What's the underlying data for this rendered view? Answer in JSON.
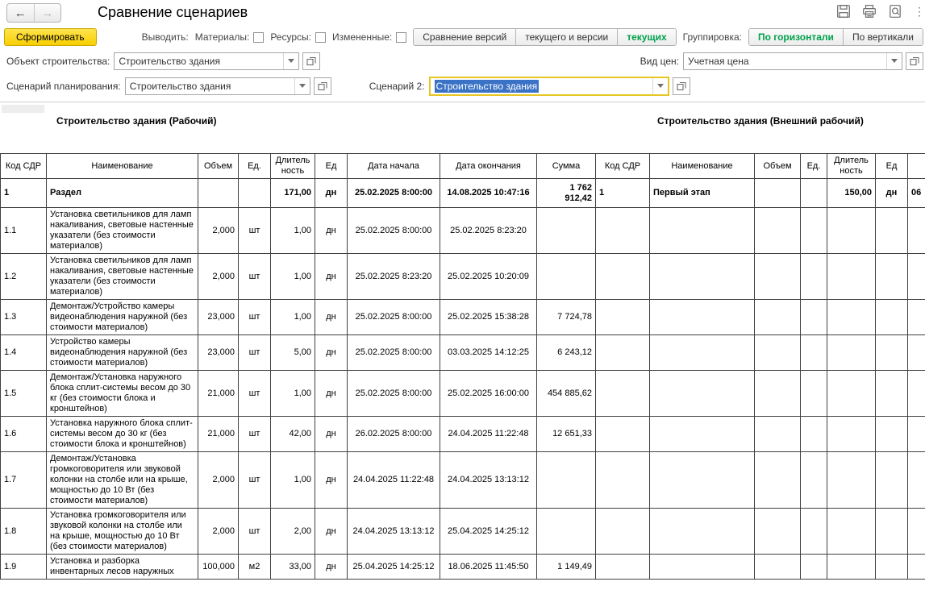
{
  "header": {
    "title": "Сравнение сценариев",
    "back_icon": "←",
    "forward_icon": "→"
  },
  "toolbar": {
    "generate_label": "Сформировать",
    "output_label": "Выводить:",
    "checkboxes": [
      {
        "label": "Материалы:",
        "checked": false
      },
      {
        "label": "Ресурсы:",
        "checked": false
      },
      {
        "label": "Измененные:",
        "checked": false
      }
    ],
    "compare_buttons": [
      {
        "label": "Сравнение версий",
        "selected": false
      },
      {
        "label": "текущего и версии",
        "selected": false
      },
      {
        "label": "текущих",
        "selected": true
      }
    ],
    "grouping_label": "Группировка:",
    "grouping_buttons": [
      {
        "label": "По горизонтали",
        "selected": true
      },
      {
        "label": "По вертикали",
        "selected": false
      }
    ],
    "accent_green": "#00a14b",
    "accent_yellow": "#f8cf02"
  },
  "filters": {
    "object_label": "Объект строительства:",
    "object_value": "Строительство здания",
    "price_label": "Вид цен:",
    "price_value": "Учетная цена",
    "scenario_label": "Сценарий планирования:",
    "scenario_value": "Строительство здания",
    "scenario2_label": "Сценарий 2:",
    "scenario2_value": "Строительство здания",
    "scenario2_selection_color": "#3a72c6",
    "scenario2_focus_border": "#e7c522"
  },
  "report": {
    "left_title": "Строительство здания (Рабочий)",
    "right_title": "Строительство здания (Внешний рабочий)",
    "columns": [
      "Код СДР",
      "Наименование",
      "Объем",
      "Ед.",
      "Длитель ность",
      "Ед",
      "Дата начала",
      "Дата окончания",
      "Сумма",
      "Код СДР",
      "Наименование",
      "Объем",
      "Ед.",
      "Длитель ность",
      "Ед",
      ""
    ],
    "rows": [
      {
        "bold": true,
        "cells": [
          "1",
          "Раздел",
          "",
          "",
          "171,00",
          "дн",
          "25.02.2025 8:00:00",
          "14.08.2025 10:47:16",
          "1 762 912,42",
          "1",
          "Первый этап",
          "",
          "",
          "150,00",
          "дн",
          "06"
        ]
      },
      {
        "cells": [
          "1.1",
          "Установка светильников для ламп накаливания, световые настенные указатели (без стоимости материалов)",
          "2,000",
          "шт",
          "1,00",
          "дн",
          "25.02.2025 8:00:00",
          "25.02.2025 8:23:20",
          "",
          "",
          "",
          "",
          "",
          "",
          "",
          ""
        ]
      },
      {
        "cells": [
          "1.2",
          "Установка светильников для ламп накаливания, световые настенные указатели (без стоимости материалов)",
          "2,000",
          "шт",
          "1,00",
          "дн",
          "25.02.2025 8:23:20",
          "25.02.2025 10:20:09",
          "",
          "",
          "",
          "",
          "",
          "",
          "",
          ""
        ]
      },
      {
        "cells": [
          "1.3",
          "Демонтаж/Устройство камеры видеонаблюдения наружной (без стоимости материалов)",
          "23,000",
          "шт",
          "1,00",
          "дн",
          "25.02.2025 8:00:00",
          "25.02.2025 15:38:28",
          "7 724,78",
          "",
          "",
          "",
          "",
          "",
          "",
          ""
        ]
      },
      {
        "cells": [
          "1.4",
          "Устройство камеры видеонаблюдения наружной (без стоимости материалов)",
          "23,000",
          "шт",
          "5,00",
          "дн",
          "25.02.2025 8:00:00",
          "03.03.2025 14:12:25",
          "6 243,12",
          "",
          "",
          "",
          "",
          "",
          "",
          ""
        ]
      },
      {
        "cells": [
          "1.5",
          "Демонтаж/Установка наружного блока сплит-системы весом до 30 кг (без стоимости блока и кронштейнов)",
          "21,000",
          "шт",
          "1,00",
          "дн",
          "25.02.2025 8:00:00",
          "25.02.2025 16:00:00",
          "454 885,62",
          "",
          "",
          "",
          "",
          "",
          "",
          ""
        ]
      },
      {
        "cells": [
          "1.6",
          "Установка наружного блока сплит-системы весом до 30 кг (без стоимости блока и кронштейнов)",
          "21,000",
          "шт",
          "42,00",
          "дн",
          "26.02.2025 8:00:00",
          "24.04.2025 11:22:48",
          "12 651,33",
          "",
          "",
          "",
          "",
          "",
          "",
          ""
        ]
      },
      {
        "cells": [
          "1.7",
          "Демонтаж/Установка громкоговорителя или звуковой колонки на столбе или на крыше, мощностью до 10 Вт (без стоимости материалов)",
          "2,000",
          "шт",
          "1,00",
          "дн",
          "24.04.2025 11:22:48",
          "24.04.2025 13:13:12",
          "",
          "",
          "",
          "",
          "",
          "",
          "",
          ""
        ]
      },
      {
        "cells": [
          "1.8",
          "Установка громкоговорителя или звуковой колонки на столбе или на крыше, мощностью до 10 Вт (без стоимости материалов)",
          "2,000",
          "шт",
          "2,00",
          "дн",
          "24.04.2025 13:13:12",
          "25.04.2025 14:25:12",
          "",
          "",
          "",
          "",
          "",
          "",
          "",
          ""
        ]
      },
      {
        "cells": [
          "1.9",
          "Установка и разборка инвентарных лесов наружных",
          "100,000",
          "м2",
          "33,00",
          "дн",
          "25.04.2025 14:25:12",
          "18.06.2025 11:45:50",
          "1 149,49",
          "",
          "",
          "",
          "",
          "",
          "",
          ""
        ]
      }
    ]
  }
}
